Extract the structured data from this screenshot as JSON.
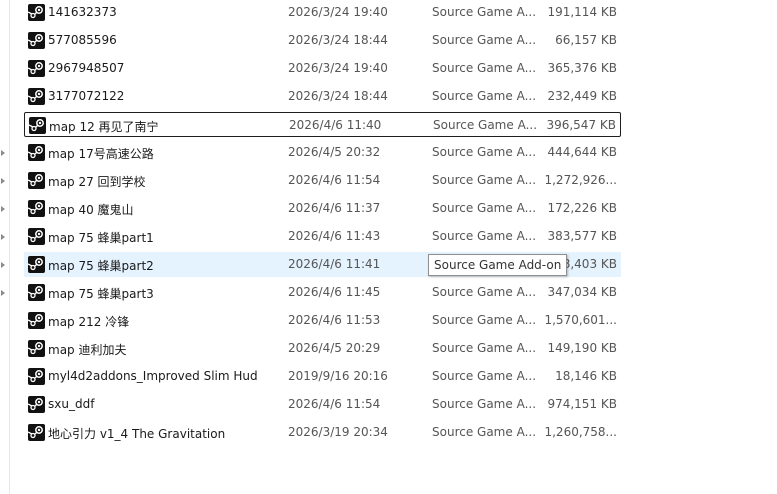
{
  "files": [
    {
      "name": "141632373",
      "date": "2026/3/24 19:40",
      "type": "Source Game A...",
      "size": "191,114 KB",
      "icon": "steam-icon"
    },
    {
      "name": "577085596",
      "date": "2026/3/24 18:44",
      "type": "Source Game A...",
      "size": "66,157 KB",
      "icon": "steam-icon"
    },
    {
      "name": "2967948507",
      "date": "2026/3/24 19:40",
      "type": "Source Game A...",
      "size": "365,376 KB",
      "icon": "steam-icon"
    },
    {
      "name": "3177072122",
      "date": "2026/3/24 18:44",
      "type": "Source Game A...",
      "size": "232,449 KB",
      "icon": "steam-icon"
    },
    {
      "name": "map 12 再见了南宁",
      "date": "2026/4/6 11:40",
      "type": "Source Game A...",
      "size": "396,547 KB",
      "icon": "steam-icon",
      "state": "selected"
    },
    {
      "name": "map 17号高速公路",
      "date": "2026/4/5 20:32",
      "type": "Source Game A...",
      "size": "444,644 KB",
      "icon": "steam-icon"
    },
    {
      "name": "map 27 回到学校",
      "date": "2026/4/6 11:54",
      "type": "Source Game A...",
      "size": "1,272,926...",
      "icon": "steam-icon"
    },
    {
      "name": "map 40 魔鬼山",
      "date": "2026/4/6 11:37",
      "type": "Source Game A...",
      "size": "172,226 KB",
      "icon": "steam-icon"
    },
    {
      "name": "map 75 蜂巢part1",
      "date": "2026/4/6 11:43",
      "type": "Source Game A...",
      "size": "383,577 KB",
      "icon": "steam-icon"
    },
    {
      "name": "map 75 蜂巢part2",
      "date": "2026/4/6 11:41",
      "type": "Source Game A...",
      "size": "398,403 KB",
      "icon": "steam-icon",
      "state": "hover"
    },
    {
      "name": "map 75 蜂巢part3",
      "date": "2026/4/6 11:45",
      "type": "Source Game A...",
      "size": "347,034 KB",
      "icon": "steam-icon"
    },
    {
      "name": "map 212 冷锋",
      "date": "2026/4/6 11:53",
      "type": "Source Game A...",
      "size": "1,570,601...",
      "icon": "steam-icon"
    },
    {
      "name": "map 迪利加夫",
      "date": "2026/4/5 20:29",
      "type": "Source Game A...",
      "size": "149,190 KB",
      "icon": "steam-icon"
    },
    {
      "name": "myl4d2addons_Improved Slim Hud",
      "date": "2019/9/16 20:16",
      "type": "Source Game A...",
      "size": "18,146 KB",
      "icon": "steam-icon"
    },
    {
      "name": "sxu_ddf",
      "date": "2026/4/6 11:54",
      "type": "Source Game A...",
      "size": "974,151 KB",
      "icon": "steam-icon"
    },
    {
      "name": "地心引力 v1_4 The Gravitation",
      "date": "2026/3/19 20:34",
      "type": "Source Game A...",
      "size": "1,260,758...",
      "icon": "steam-icon"
    }
  ],
  "tooltip": {
    "text": "Source Game Add-on"
  },
  "colors": {
    "selected_border": "#1f1f1f",
    "hover_background": "#e5f3ff",
    "tooltip_border": "#8f8f8f"
  }
}
